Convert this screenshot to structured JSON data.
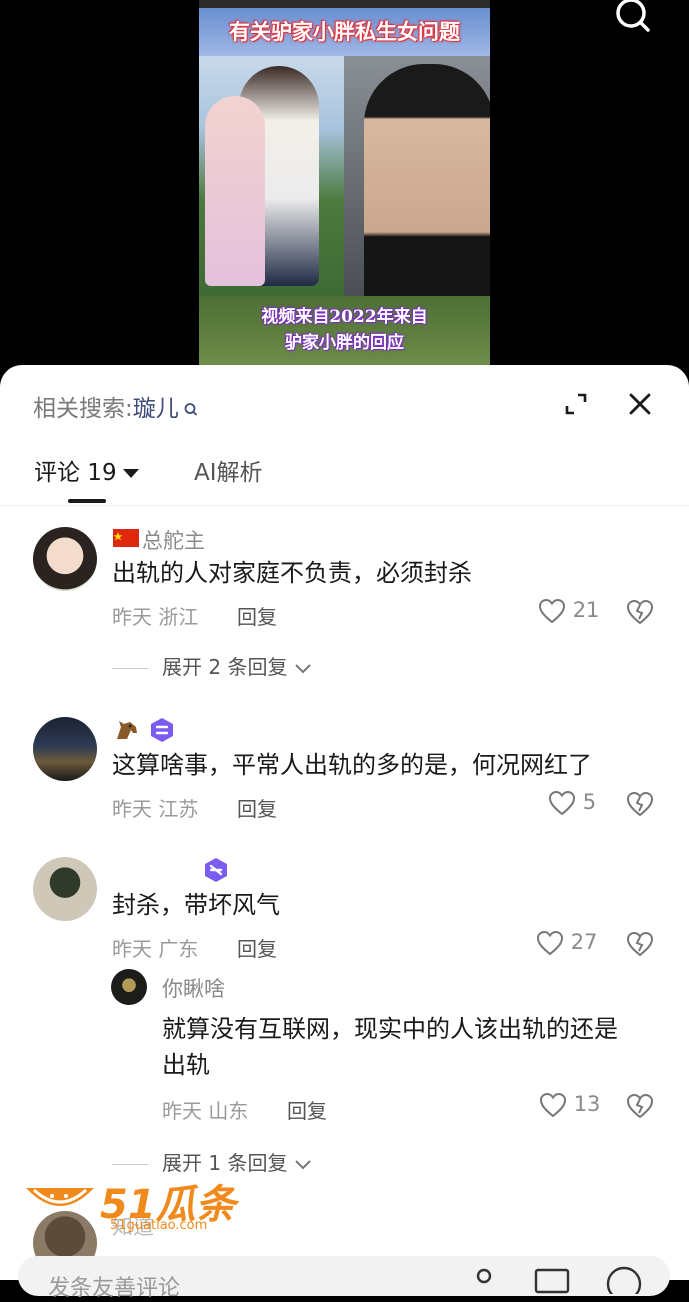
{
  "video": {
    "banner_top": "有关驴家小胖私生女问题",
    "banner_bottom": "视频来自2022年来自\n驴家小胖的回应"
  },
  "sheet": {
    "related_label": "相关搜索:",
    "related_keyword": "璇儿",
    "tabs": {
      "comments": "评论 19",
      "ai": "AI解析"
    }
  },
  "comments": [
    {
      "username": "总舵主",
      "text": "出轨的人对家庭不负责，必须封杀",
      "time": "昨天",
      "location": "浙江",
      "reply_label": "回复",
      "likes": "21",
      "expand": "展开 2 条回复"
    },
    {
      "username": "",
      "text": "这算啥事，平常人出轨的多的是，何况网红了",
      "time": "昨天",
      "location": "江苏",
      "reply_label": "回复",
      "likes": "5"
    },
    {
      "username": "",
      "text": "封杀，带坏风气",
      "time": "昨天",
      "location": "广东",
      "reply_label": "回复",
      "likes": "27",
      "sub_reply": {
        "username": "你瞅啥",
        "text_line1": "就算没有互联网，现实中的人该出轨的还是",
        "text_line2": "出轨",
        "time": "昨天",
        "location": "山东",
        "reply_label": "回复",
        "likes": "13"
      },
      "expand": "展开 1 条回复"
    }
  ],
  "partial_next_username": "知道",
  "watermark": {
    "text": "51瓜条",
    "sub": "51guatiao.com"
  },
  "input": {
    "placeholder": "发条友善评论"
  },
  "colors": {
    "keyword": "#3d4c7a",
    "badge_purple": "#7b5cf0",
    "watermark_orange": "#f08a1c"
  }
}
